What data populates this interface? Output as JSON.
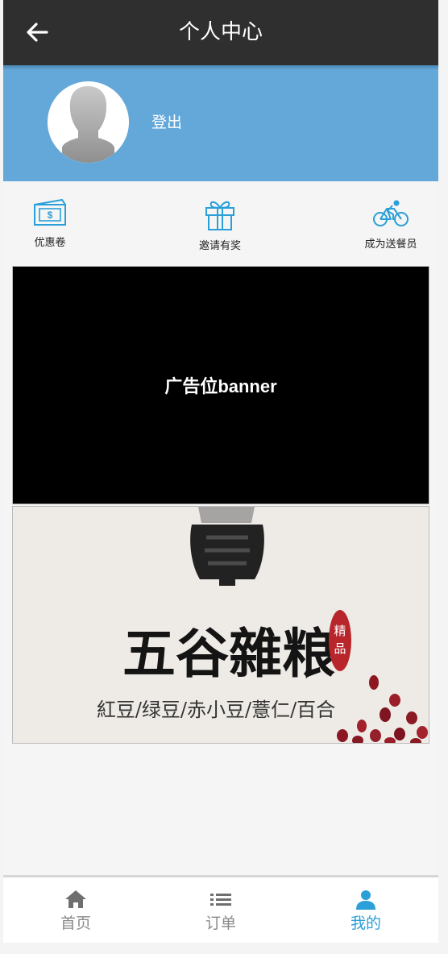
{
  "header": {
    "title": "个人中心",
    "back_icon": "arrow-left-icon"
  },
  "profile": {
    "avatar": "default-avatar",
    "logout_label": "登出",
    "background_color": "#64a8d9"
  },
  "quick_actions": [
    {
      "label": "优惠卷",
      "icon": "money-bill-icon"
    },
    {
      "label": "邀请有奖",
      "icon": "gift-icon"
    },
    {
      "label": "成为送餐员",
      "icon": "bicycle-icon"
    }
  ],
  "banner": {
    "text": "广告位banner"
  },
  "promo": {
    "title": "五谷雜粮",
    "seal": "精品",
    "subtitle": "紅豆/绿豆/赤小豆/薏仁/百合"
  },
  "tabbar": {
    "active_color": "#2a9fd8",
    "items": [
      {
        "label": "首页",
        "icon": "home-icon",
        "active": false
      },
      {
        "label": "订单",
        "icon": "list-icon",
        "active": false
      },
      {
        "label": "我的",
        "icon": "user-icon",
        "active": true
      }
    ]
  }
}
